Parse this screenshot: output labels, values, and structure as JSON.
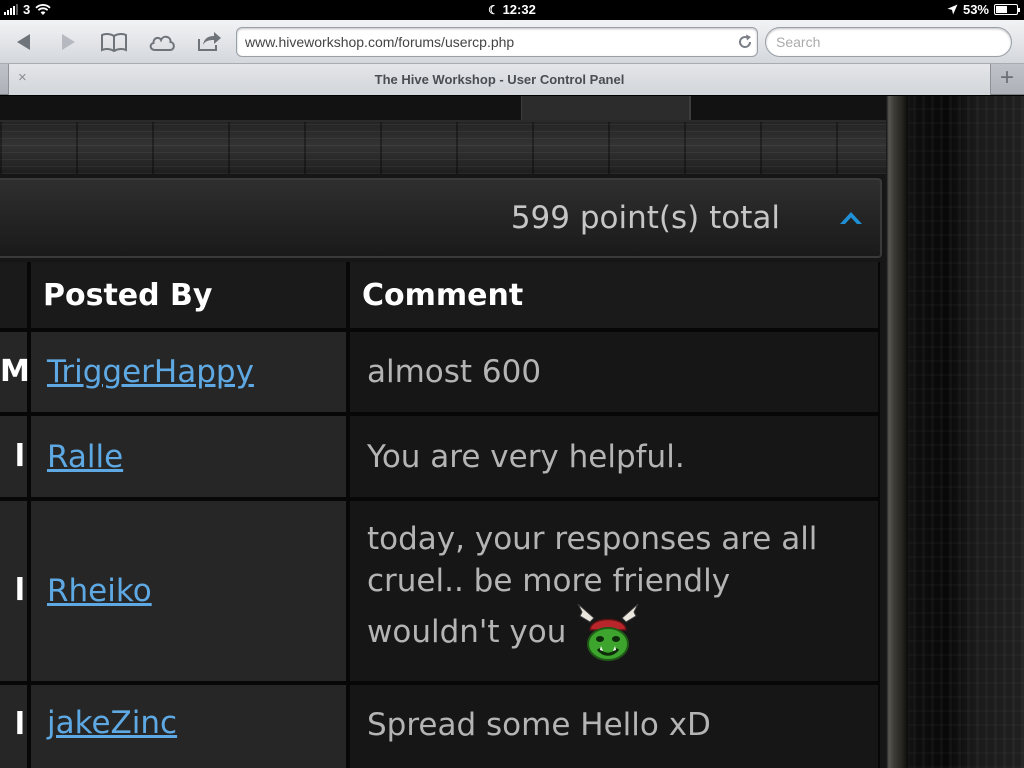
{
  "status_bar": {
    "carrier": "3",
    "time": "12:32",
    "battery_percent": "53%",
    "battery_level": 0.53
  },
  "toolbar": {
    "url": "www.hiveworkshop.com/forums/usercp.php",
    "search_placeholder": "Search",
    "icons": [
      "back-icon",
      "forward-icon",
      "bookmarks-icon",
      "icloud-tabs-icon",
      "share-icon",
      "reload-icon"
    ]
  },
  "tab": {
    "title": "The Hive Workshop - User Control Panel",
    "close_label": "×",
    "new_tab_label": "+"
  },
  "points": {
    "total_text": "599 point(s) total"
  },
  "comments_table": {
    "headers": {
      "posted_by": "Posted By",
      "comment": "Comment"
    },
    "rows": [
      {
        "date_fragment": "M",
        "posted_by": "TriggerHappy",
        "comment": "almost 600",
        "has_smiley": false
      },
      {
        "date_fragment": "l",
        "posted_by": "Ralle",
        "comment": "You are very helpful.",
        "has_smiley": false
      },
      {
        "date_fragment": "l",
        "posted_by": "Rheiko",
        "comment": "today, your responses are all cruel.. be more friendly wouldn't you",
        "has_smiley": true
      },
      {
        "date_fragment": "l",
        "posted_by": "jakeZinc",
        "comment": "Spread some Hello xD",
        "has_smiley": false
      }
    ]
  },
  "colors": {
    "link": "#5ea9e3",
    "collapse_arrow": "#1f8fd6",
    "page_background": "#161616"
  }
}
